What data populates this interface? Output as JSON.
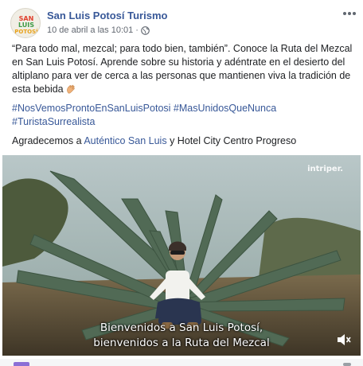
{
  "post": {
    "page_name": "San Luis Potosí Turismo",
    "date": "10 de abril a las 10:01",
    "separator": "·",
    "avatar_words": [
      "SAN",
      "LUIS",
      "POTOSÍ"
    ],
    "body_paragraph": "“Para todo mal, mezcal; para todo bien, también”. Conoce la Ruta del Mezcal en San Luis Potosí. Aprende sobre su historia y adéntrate en el desierto del altiplano para ver de cerca a las personas que mantienen viva la tradición de esta bebida",
    "hashtags": [
      "#NosVemosProntoEnSanLuisPotosi",
      "#MasUnidosQueNunca",
      "#TuristaSurrealista"
    ],
    "thanks_prefix": "Agradecemos a ",
    "thanks_link": "Auténtico San Luis",
    "thanks_suffix": " y Hotel City Centro Progreso"
  },
  "video": {
    "watermark": "intriper.",
    "subtitle_line1": "Bienvenidos a San Luis Potosí,",
    "subtitle_line2": "bienvenidos a la Ruta del Mezcal",
    "muted": true
  },
  "icons": {
    "more": "more-options-icon",
    "privacy": "globe-icon",
    "emoji": "clapping-hands-icon",
    "volume": "volume-muted-icon"
  },
  "colors": {
    "link": "#385898",
    "meta": "#616770"
  }
}
